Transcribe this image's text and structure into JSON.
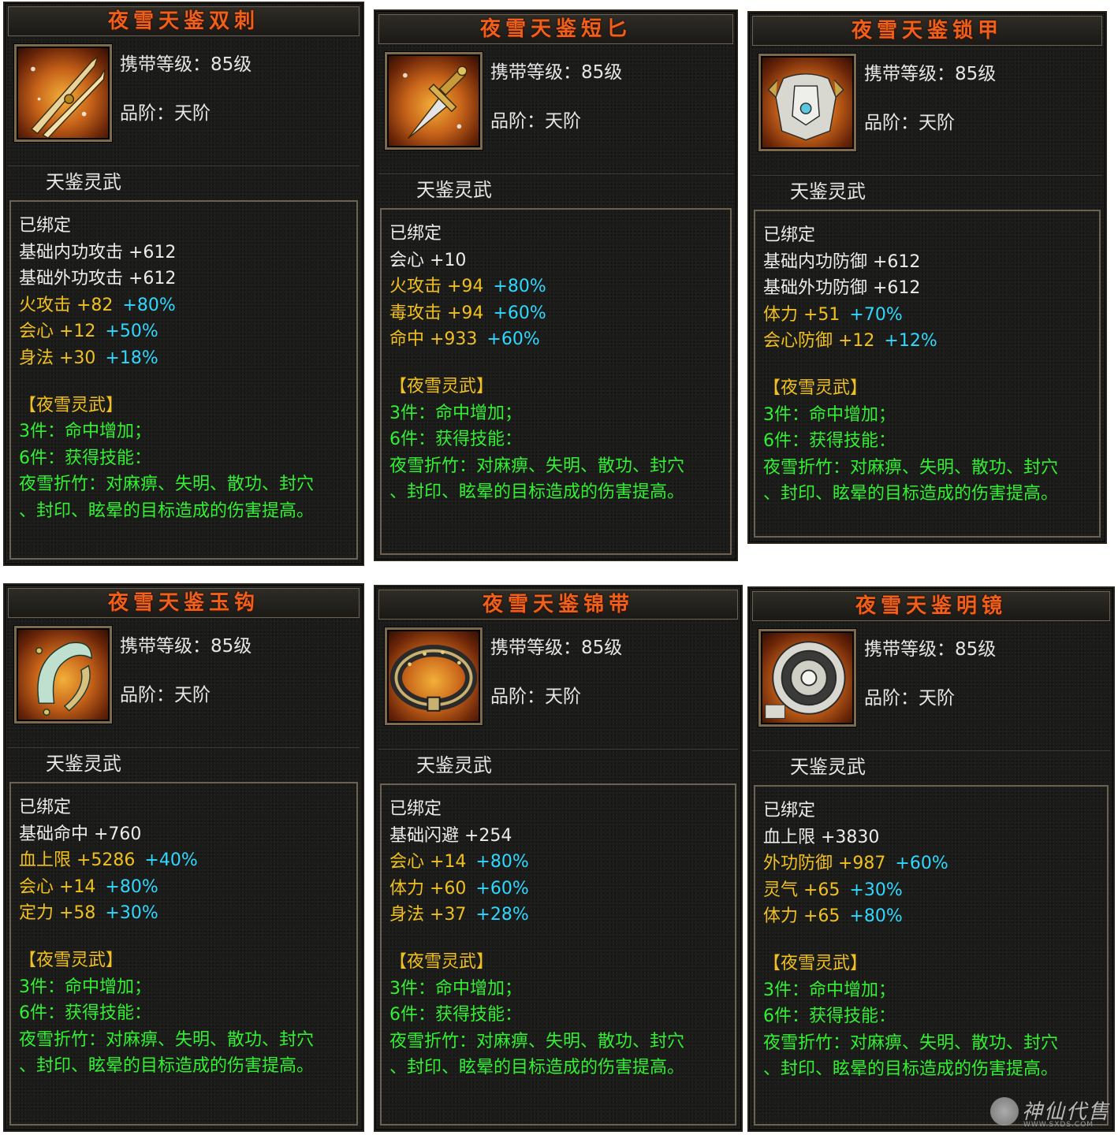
{
  "common": {
    "level": "携带等级：85级",
    "grade": "品阶：天阶",
    "series": "天鉴灵武",
    "bound": "已绑定",
    "set_name": "【夜雪灵武】",
    "set_3": "3件：命中增加；",
    "set_6": "6件：获得技能：",
    "skill_1": "夜雪折竹：对麻痹、失明、散功、封穴",
    "skill_2": "、封印、眩晕的目标造成的伤害提高。"
  },
  "cards": [
    {
      "title": "夜雪天鉴双刺",
      "icon": "twin-spear-icon",
      "stats": [
        {
          "text": "基础内功攻击 +612",
          "color": "white"
        },
        {
          "text": "基础外功攻击 +612",
          "color": "white"
        },
        {
          "text": "火攻击 +82",
          "bonus": "+80%",
          "color": "yellow"
        },
        {
          "text": "会心 +12",
          "bonus": "+50%",
          "color": "yellow"
        },
        {
          "text": "身法 +30",
          "bonus": "+18%",
          "color": "yellow"
        }
      ]
    },
    {
      "title": "夜雪天鉴短匕",
      "icon": "dagger-icon",
      "stats": [
        {
          "text": "会心 +10",
          "color": "white"
        },
        {
          "text": "火攻击 +94",
          "bonus": "+80%",
          "color": "yellow"
        },
        {
          "text": "毒攻击 +94",
          "bonus": "+60%",
          "color": "yellow"
        },
        {
          "text": "命中 +933",
          "bonus": "+60%",
          "color": "yellow"
        }
      ]
    },
    {
      "title": "夜雪天鉴锁甲",
      "icon": "armor-icon",
      "stats": [
        {
          "text": "基础内功防御 +612",
          "color": "white"
        },
        {
          "text": "基础外功防御 +612",
          "color": "white"
        },
        {
          "text": "体力 +51",
          "bonus": "+70%",
          "color": "yellow"
        },
        {
          "text": "会心防御 +12",
          "bonus": "+12%",
          "color": "yellow"
        }
      ]
    },
    {
      "title": "夜雪天鉴玉钩",
      "icon": "jade-hook-icon",
      "stats": [
        {
          "text": "基础命中 +760",
          "color": "white"
        },
        {
          "text": "血上限 +5286",
          "bonus": "+40%",
          "color": "yellow"
        },
        {
          "text": "会心 +14",
          "bonus": "+80%",
          "color": "yellow"
        },
        {
          "text": "定力 +58",
          "bonus": "+30%",
          "color": "yellow"
        }
      ]
    },
    {
      "title": "夜雪天鉴锦带",
      "icon": "belt-icon",
      "stats": [
        {
          "text": "基础闪避 +254",
          "color": "white"
        },
        {
          "text": "会心 +14",
          "bonus": "+80%",
          "color": "yellow"
        },
        {
          "text": "体力 +60",
          "bonus": "+60%",
          "color": "yellow"
        },
        {
          "text": "身法 +37",
          "bonus": "+28%",
          "color": "yellow"
        }
      ]
    },
    {
      "title": "夜雪天鉴明镜",
      "icon": "mirror-icon",
      "stats": [
        {
          "text": "血上限 +3830",
          "color": "white"
        },
        {
          "text": "外功防御 +987",
          "bonus": "+60%",
          "color": "yellow"
        },
        {
          "text": "灵气 +65",
          "bonus": "+30%",
          "color": "yellow"
        },
        {
          "text": "体力 +65",
          "bonus": "+80%",
          "color": "yellow"
        }
      ]
    }
  ],
  "watermark": {
    "text": "神仙代售",
    "url": "WWW.SXDS.COM"
  }
}
